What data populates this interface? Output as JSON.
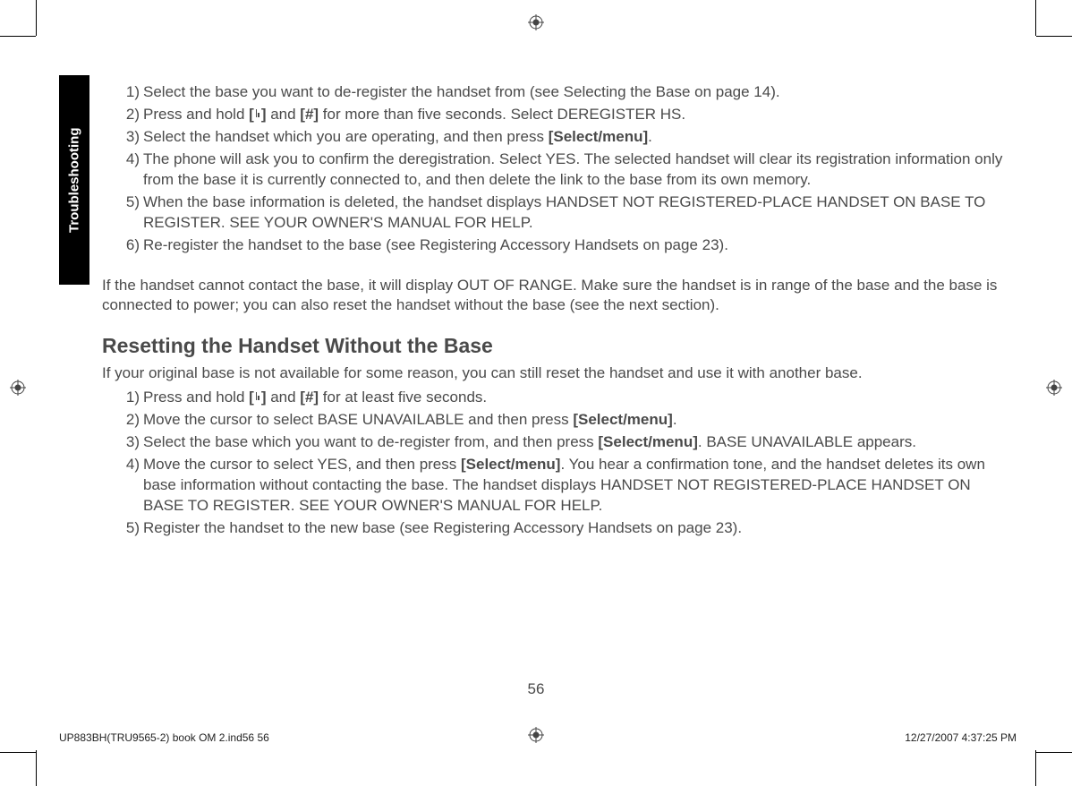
{
  "tab_label": "Troubleshooting",
  "list1": {
    "items": [
      {
        "n": "1)",
        "text": "Select the base you want to de-register the handset from (see Selecting the Base on page 14)."
      },
      {
        "n": "2)",
        "prefix": "Press and hold ",
        "btn1_open": "[",
        "btn1_close": "]",
        "mid": " and ",
        "btn2": "[#]",
        "suffix": " for more than five seconds. Select DEREGISTER HS."
      },
      {
        "n": "3)",
        "prefix": "Select the handset which you are operating, and then press ",
        "btn": "[Select/menu]",
        "suffix": "."
      },
      {
        "n": "4)",
        "text": "The phone will ask you to confirm the deregistration. Select YES. The selected handset will clear its registration information only from the base it is currently connected to, and then delete the link to the base from its own memory."
      },
      {
        "n": "5)",
        "text": "When the base information is deleted, the handset displays HANDSET NOT REGISTERED-PLACE HANDSET ON BASE TO REGISTER. SEE YOUR OWNER'S MANUAL FOR HELP."
      },
      {
        "n": "6)",
        "text": "Re-register the handset to the base (see Registering Accessory Handsets on page 23)."
      }
    ]
  },
  "paragraph": "If the handset cannot contact the base, it will display OUT OF RANGE. Make sure the handset is in range of the base and the base is connected to power; you can also reset the handset without the base (see the next section).",
  "heading": "Resetting the Handset Without the Base",
  "intro2": "If your original base is not available for some reason, you can still reset the handset and use it with another base.",
  "list2": {
    "items": [
      {
        "n": "1)",
        "prefix": "Press and hold ",
        "btn1_open": "[",
        "btn1_close": "]",
        "mid": " and ",
        "btn2": "[#]",
        "suffix": " for at least five seconds."
      },
      {
        "n": "2)",
        "prefix": "Move the cursor to select BASE UNAVAILABLE and then press ",
        "btn": "[Select/menu]",
        "suffix": "."
      },
      {
        "n": "3)",
        "prefix": "Select the base which you want to de-register from, and then press ",
        "btn": "[Select/menu]",
        "suffix": ". BASE UNAVAILABLE appears."
      },
      {
        "n": "4)",
        "prefix": "Move the cursor to select YES, and then press ",
        "btn": "[Select/menu]",
        "suffix": ". You hear a confirmation tone, and the handset deletes its own base information without contacting the base. The handset displays HANDSET NOT REGISTERED-PLACE HANDSET ON BASE TO REGISTER. SEE YOUR OWNER'S MANUAL FOR HELP."
      },
      {
        "n": "5)",
        "text": "Register the handset to the new base (see Registering Accessory Handsets on page 23)."
      }
    ]
  },
  "page_number": "56",
  "footer_file": "UP883BH(TRU9565-2) book OM 2.ind56   56",
  "footer_date": "12/27/2007   4:37:25 PM"
}
